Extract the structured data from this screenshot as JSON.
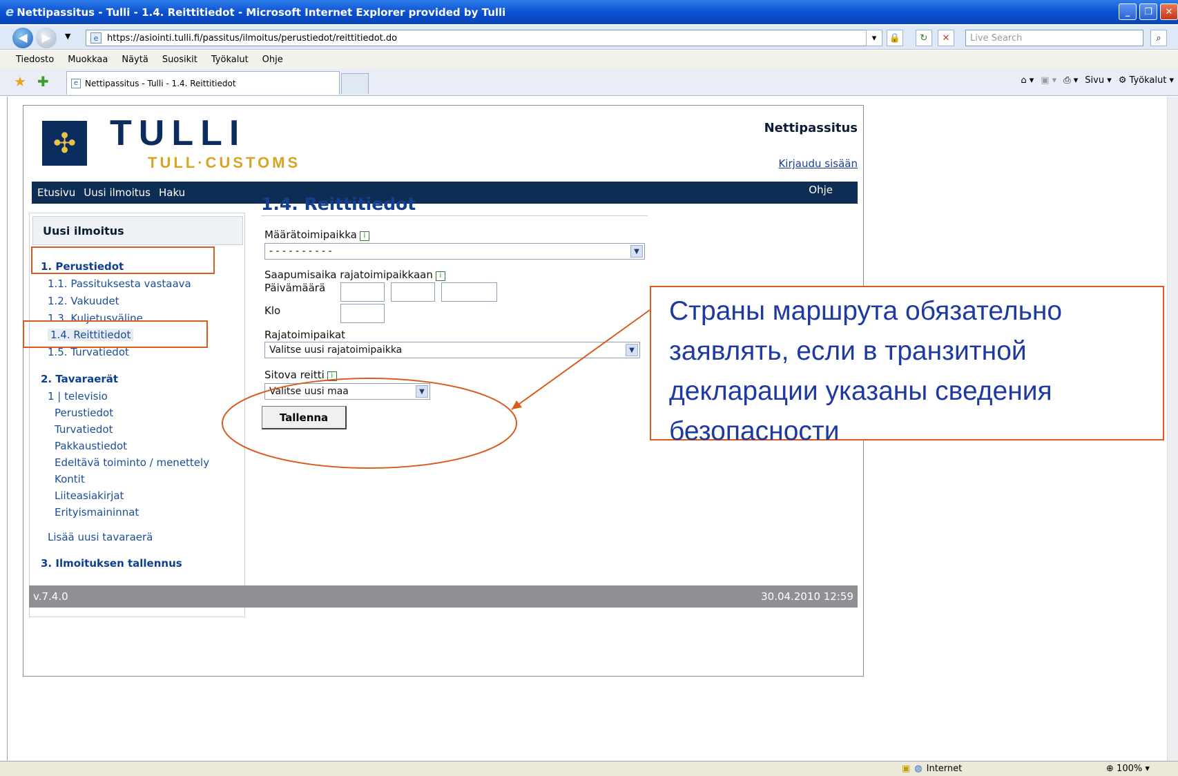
{
  "window": {
    "title": "Nettipassitus - Tulli - 1.4. Reittitiedot - Microsoft Internet Explorer provided by Tulli"
  },
  "browser": {
    "url": "https://asiointi.tulli.fi/passitus/ilmoitus/perustiedot/reittitiedot.do",
    "search_placeholder": "Live Search",
    "menu": [
      "Tiedosto",
      "Muokkaa",
      "Näytä",
      "Suosikit",
      "Työkalut",
      "Ohje"
    ],
    "tab_title": "Nettipassitus - Tulli - 1.4. Reittitiedot",
    "toolbar": {
      "page": "Sivu",
      "tools": "Työkalut"
    },
    "status": {
      "zone": "Internet",
      "zoom": "100%"
    }
  },
  "header": {
    "brand": "TULLI",
    "brand_sub": "TULL·CUSTOMS",
    "app_title": "Nettipassitus",
    "login_link": "Kirjaudu sisään"
  },
  "topnav": {
    "items": [
      "Etusivu",
      "Uusi ilmoitus",
      "Haku"
    ],
    "help": "Ohje"
  },
  "sidebar": {
    "heading": "Uusi ilmoitus",
    "section1": "1. Perustiedot",
    "items1": [
      "1.1. Passituksesta vastaava",
      "1.2. Vakuudet",
      "1.3. Kuljetusväline",
      "1.4. Reittitiedot",
      "1.5. Turvatiedot"
    ],
    "section2": "2. Tavaraerät",
    "goods_item": "1 | televisio",
    "items2": [
      "Perustiedot",
      "Turvatiedot",
      "Pakkaustiedot",
      "Edeltävä toiminto / menettely",
      "Kontit",
      "Liiteasiakirjat",
      "Erityismaininnat"
    ],
    "add_item": "Lisää uusi tavaraerä",
    "section3": "3. Ilmoituksen tallennus"
  },
  "form": {
    "heading": "1.4. Reittitiedot",
    "destination_label": "Määrätoimipaikka",
    "destination_value": "- - - - - - - - - -",
    "arrival_label": "Saapumisaika rajatoimipaikkaan",
    "date_label": "Päivämäärä",
    "time_label": "Klo",
    "border_label": "Rajatoimipaikat",
    "border_value": "Valitse uusi rajatoimipaikka",
    "route_label": "Sitova reitti",
    "route_value": "Valitse uusi maa",
    "save_button": "Tallenna"
  },
  "footer": {
    "version": "v.7.4.0",
    "datetime": "30.04.2010 12:59"
  },
  "annotation": {
    "text": "Страны маршрута обязательно заявлять, если в транзитной декларации указаны сведения безопасности",
    "color": "#d95a1a"
  }
}
